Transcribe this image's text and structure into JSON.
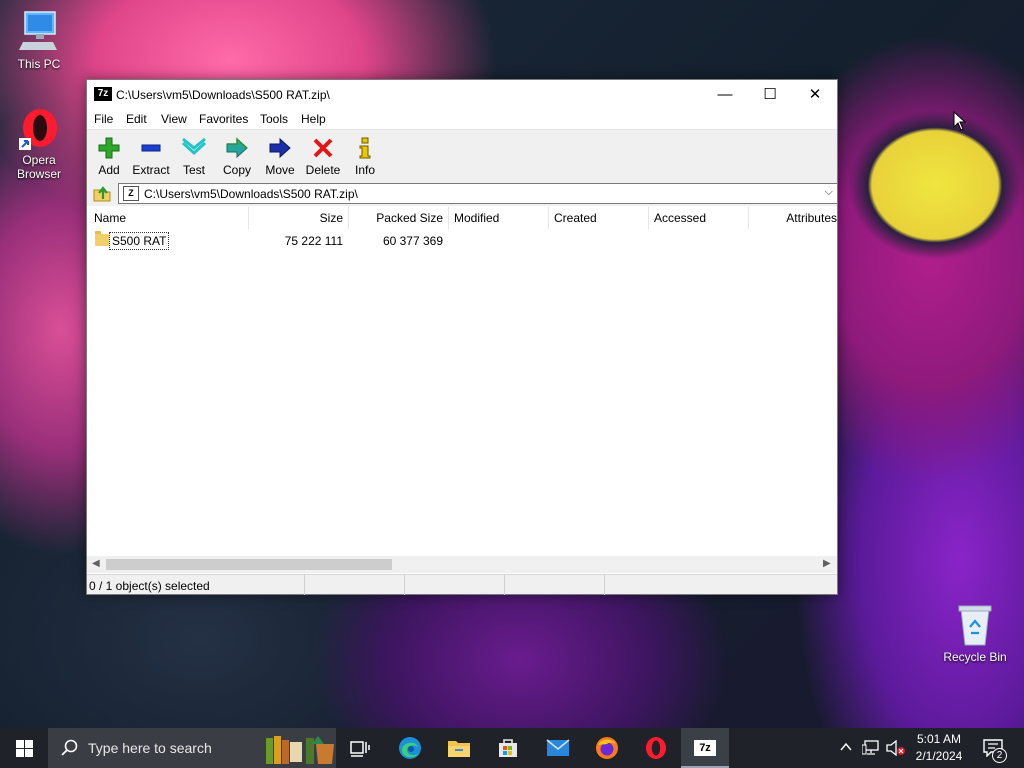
{
  "desktop": {
    "icons": [
      {
        "label": "This PC"
      },
      {
        "label": "Opera Browser"
      },
      {
        "label": "Recycle Bin"
      }
    ]
  },
  "window": {
    "title": "C:\\Users\\vm5\\Downloads\\S500 RAT.zip\\",
    "app_badge": "7z",
    "controls": {
      "minimize": "—",
      "maximize": "☐",
      "close": "✕"
    },
    "menu": [
      "File",
      "Edit",
      "View",
      "Favorites",
      "Tools",
      "Help"
    ],
    "toolbar": [
      {
        "label": "Add",
        "icon": "add-icon"
      },
      {
        "label": "Extract",
        "icon": "extract-icon"
      },
      {
        "label": "Test",
        "icon": "test-icon"
      },
      {
        "label": "Copy",
        "icon": "copy-icon"
      },
      {
        "label": "Move",
        "icon": "move-icon"
      },
      {
        "label": "Delete",
        "icon": "delete-icon"
      },
      {
        "label": "Info",
        "icon": "info-icon"
      }
    ],
    "address": {
      "path": "C:\\Users\\vm5\\Downloads\\S500 RAT.zip\\",
      "zip_badge": "Z"
    },
    "columns": [
      "Name",
      "Size",
      "Packed Size",
      "Modified",
      "Created",
      "Accessed",
      "Attributes"
    ],
    "rows": [
      {
        "name": "S500 RAT",
        "size": "75 222 111",
        "packed_size": "60 377 369",
        "modified": "",
        "created": "",
        "accessed": "",
        "attributes": ""
      }
    ],
    "status": {
      "selection": "0 / 1 object(s) selected"
    }
  },
  "taskbar": {
    "search_placeholder": "Type here to search",
    "pinned": [
      "task-view-icon",
      "edge-icon",
      "file-explorer-icon",
      "store-icon",
      "mail-icon",
      "firefox-icon",
      "opera-icon",
      "7zip-icon"
    ],
    "active_app": "7zip-icon",
    "active_badge": "7z",
    "clock": {
      "time": "5:01 AM",
      "date": "2/1/2024"
    },
    "notifications": {
      "count": "2"
    }
  },
  "colors": {
    "taskbar": "#1f2228",
    "toolbar_bg": "#f0f0f0",
    "add_green": "#2da82d",
    "extract_blue": "#1c3fd6",
    "test_teal": "#22c4c8",
    "delete_red": "#e01818",
    "info_yellow": "#e8c800"
  }
}
